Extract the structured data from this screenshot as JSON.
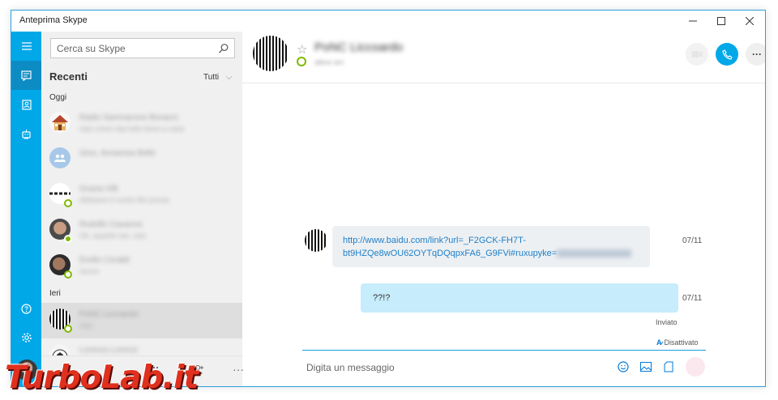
{
  "window": {
    "title": "Anteprima Skype",
    "controls": [
      "minimize-icon",
      "maximize-icon",
      "close-icon"
    ]
  },
  "rail": {
    "top_items": [
      {
        "icon": "hamburger-icon"
      },
      {
        "icon": "chat-icon",
        "active": true
      },
      {
        "icon": "contacts-icon"
      },
      {
        "icon": "bot-icon"
      }
    ],
    "bottom_items": [
      {
        "icon": "help-icon"
      },
      {
        "icon": "settings-icon"
      },
      {
        "icon": "user-avatar"
      }
    ]
  },
  "sidebar": {
    "search_placeholder": "Cerca su Skype",
    "recent_title": "Recenti",
    "filter_label": "Tutti",
    "groups": [
      {
        "label": "Oggi",
        "contacts": [
          {
            "name": "Radio Sammarone Bonacci",
            "message": "ciao come stai tutto bene a casa",
            "avatar": "house",
            "status": "none"
          },
          {
            "name": "Gino, Annarosa Bello",
            "message": "",
            "avatar": "group",
            "status": "none"
          },
          {
            "name": "Grazia Villi",
            "message": "Abbiamo il vostro file pronto",
            "avatar": "logo",
            "status": "away"
          },
          {
            "name": "Rodolfo Cavanna",
            "message": "Ok, aspetto tue, ciao",
            "avatar": "photo1",
            "status": "online"
          },
          {
            "name": "Emilio Ceraldi",
            "message": "sicuro",
            "avatar": "photo2",
            "status": "away"
          }
        ]
      },
      {
        "label": "Ieri",
        "contacts": [
          {
            "name": "PoNC Liccoardo",
            "message": "ciao",
            "avatar": "stripes",
            "status": "away",
            "selected": true
          },
          {
            "name": "Lorenzo Lorenzi",
            "message": "",
            "avatar": "ball",
            "status": "none"
          }
        ]
      }
    ],
    "bottom_icons": [
      "dialpad-icon",
      "add-contact-icon",
      "more-icon"
    ]
  },
  "conversation": {
    "name": "PoNC Liccoardo",
    "subtitle": "attivo ieri",
    "header_icons": [
      "video-call-icon",
      "call-icon",
      "more-icon"
    ],
    "messages": [
      {
        "direction": "in",
        "text_line1": "http://www.baidu.com/link?url=_F2GCK-FH7T-",
        "text_line2": "bt9HZQe8wOU62OYTqDQqpxFA6_G9FVi#ruxupyke=",
        "date": "07/11"
      },
      {
        "direction": "out",
        "text": "??!?",
        "date": "07/11",
        "status": "Inviato"
      }
    ],
    "translator_label": "Disattivato",
    "composer_placeholder": "Digita un messaggio",
    "composer_icons": [
      "emoji-icon",
      "image-icon",
      "file-icon",
      "send-icon"
    ]
  },
  "watermark": "TurboLab.it",
  "colors": {
    "accent": "#00a8e8",
    "rail_active": "#0d8cc4",
    "out_bubble": "#c7ecfc",
    "in_bubble": "#edf0f3",
    "link": "#1e7fc8",
    "online": "#7fba00"
  }
}
